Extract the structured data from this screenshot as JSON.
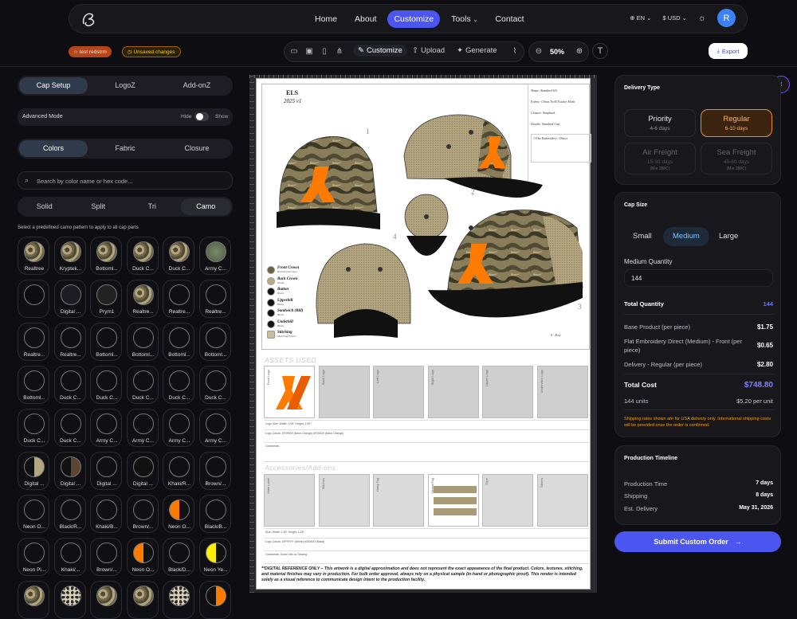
{
  "nav": {
    "links": [
      "Home",
      "About",
      "Customize",
      "Tools",
      "Contact"
    ],
    "active": "Customize",
    "lang": "EN",
    "currency": "$ USD",
    "avatar_initial": "R"
  },
  "toolbar": {
    "project_badge": "test redstrm",
    "unsaved_badge": "Unsaved changes",
    "modes": [
      "Customize",
      "Upload",
      "Generate"
    ],
    "zoom": "50%",
    "export_label": "Export"
  },
  "left": {
    "main_tabs": [
      "Cap Setup",
      "LogoZ",
      "Add-onZ"
    ],
    "advanced_mode_label": "Advanced Mode",
    "hide_label": "Hide",
    "show_label": "Show",
    "sub_tabs": [
      "Colors",
      "Fabric",
      "Closure"
    ],
    "search_placeholder": "Search by color name or hex code...",
    "pattern_tabs": [
      "Solid",
      "Split",
      "Tri",
      "Camo"
    ],
    "hint": "Select a predefined camo pattern to apply to all cap parts",
    "swatches": [
      "Realtree",
      "Kryptek...",
      "Bottoml...",
      "Duck C...",
      "Duck C...",
      "Army C...",
      "",
      "Digital ...",
      "Prym1",
      "Realtre...",
      "Realtre...",
      "Realtre...",
      "Realtre...",
      "Realtre...",
      "Bottoml...",
      "Bottoml...",
      "Bottoml...",
      "Bottoml...",
      "Bottoml...",
      "Duck C...",
      "Duck C...",
      "Duck C...",
      "Duck C...",
      "Duck C...",
      "Duck C...",
      "Duck C...",
      "Army C...",
      "Army C...",
      "Army C...",
      "Army C...",
      "Digital ...",
      "Digital ...",
      "Digital ...",
      "Digital ...",
      "Khaki/R...",
      "Brown/...",
      "Neon O...",
      "Black/R...",
      "Khaki/B...",
      "Brown/...",
      "Neon O...",
      "Black/B...",
      "Neon Pi...",
      "Khaki/...",
      "Brown/...",
      "Neon O...",
      "Black/D...",
      "Neon Ye..."
    ]
  },
  "sheet": {
    "brand": "ELS",
    "version": "2025 v1",
    "specs": [
      "Shape: Standard 6/6",
      "Fabric: China Twill/Trucker Mesh",
      "Closure: Snapback",
      "Details: Standard Cap"
    ],
    "spec_note": "1 Flat Embroidery - Direct",
    "view_numbers": [
      "1",
      "2",
      "3",
      "4"
    ],
    "brim_note": "8 - Row",
    "legend": [
      {
        "name": "Front Crown",
        "sub": "Bottomland camo",
        "color": "#6b6345"
      },
      {
        "name": "Back Crown",
        "sub": "Khaki",
        "color": "#b9ab86"
      },
      {
        "name": "Button",
        "sub": "Black",
        "color": "#111111"
      },
      {
        "name": "Upperbill",
        "sub": "Black",
        "color": "#111111"
      },
      {
        "name": "Sandwich (Bill)",
        "sub": "Black",
        "color": "#111111"
      },
      {
        "name": "Underbill",
        "sub": "Black",
        "color": "#111111"
      },
      {
        "name": "Stitching",
        "sub": "Matching Fabric",
        "color": "#c8bd9a"
      }
    ],
    "assets_title": "ASSETS USED",
    "asset_labels": [
      "Front Logo",
      "Back Logo",
      "Left Logo",
      "Right Logo",
      "Upper Logo",
      "Undervisor Logo"
    ],
    "asset_meta": [
      "Logo Size: Width: 2.09\" Height: 1.69\"",
      "Logo Colors: #F09020 (Neon Orange) #F05020 (Neon Orange)",
      "Comments:"
    ],
    "addons_title": "Accessories/Add-ons:",
    "addon_labels": [
      "Main Label",
      "Stitches",
      "Hang Tag",
      "Sticker/Tag",
      "Tape",
      "Others"
    ],
    "addon_meta": [
      "Size: Width: 1.50\" Height: 1.25\"",
      "Logo Colors: #FFFFFF (White) #000000 (Black)",
      "Comments: Some info on Sewing"
    ],
    "disclaimer": "**DIGITAL REFERENCE ONLY – This artwork is a digital approximation and does not represent the exact appearance of the final product. Colors, textures, stitching, and material finishes may vary in production. For bulk order approval, always rely on a physical sample (in-hand or photographic proof). This render is intended solely as a  visual reference to communicate design intent to the production facility."
  },
  "delivery": {
    "title": "Delivery Type",
    "options": [
      {
        "name": "Priority",
        "days": "4-6 days",
        "sub": ""
      },
      {
        "name": "Regular",
        "days": "6-10 days",
        "sub": ""
      },
      {
        "name": "Air Freight",
        "days": "15-30 days",
        "sub": "(Min 288C)"
      },
      {
        "name": "Sea Freight",
        "days": "45-60 days",
        "sub": "(Min 288C)"
      }
    ],
    "selected": "Regular"
  },
  "capsize": {
    "title": "Cap Size",
    "sizes": [
      "Small",
      "Medium",
      "Large"
    ],
    "selected": "Medium",
    "qty_label": "Medium Quantity",
    "qty_value": "144",
    "total_qty_label": "Total Quantity",
    "total_qty_value": "144",
    "lines": [
      {
        "label": "Base Product (per piece)",
        "value": "$1.75"
      },
      {
        "label": "Flat Embroidery Direct (Medium) - Front (per piece)",
        "value": "$0.65"
      },
      {
        "label": "Delivery - Regular (per piece)",
        "value": "$2.80"
      }
    ],
    "total_cost_label": "Total Cost",
    "total_cost_value": "$748.80",
    "units": "144 units",
    "per_unit": "$5.20 per unit",
    "shipping_note": "Shipping rates shown are for USA delivery only. International shipping costs will be provided once the order is confirmed."
  },
  "timeline": {
    "title": "Production Timeline",
    "rows": [
      {
        "label": "Production Time",
        "value": "7 days"
      },
      {
        "label": "Shipping",
        "value": "8 days"
      },
      {
        "label": "Est. Delivery",
        "value": "May 31, 2026"
      }
    ]
  },
  "submit_label": "Submit Custom Order",
  "colors": {
    "accent": "#4b55f0",
    "orange": "#f08a24",
    "camo_dark": "#4f4a33",
    "khaki": "#b3a57f",
    "neon_orange": "#ff7a00",
    "neon_pink": "#ff2d95",
    "neon_yellow": "#ffee00"
  },
  "icons": [
    "logo-icon",
    "globe-icon",
    "sun-icon",
    "star-icon",
    "clock-icon",
    "folder-icon",
    "save-icon",
    "document-icon",
    "share-icon",
    "wand-icon",
    "upload-icon",
    "sparkle-icon",
    "paperclip-icon",
    "zoom-out-icon",
    "zoom-in-icon",
    "text-icon",
    "download-icon",
    "search-icon",
    "arrow-right-icon",
    "chevron-left-icon"
  ]
}
